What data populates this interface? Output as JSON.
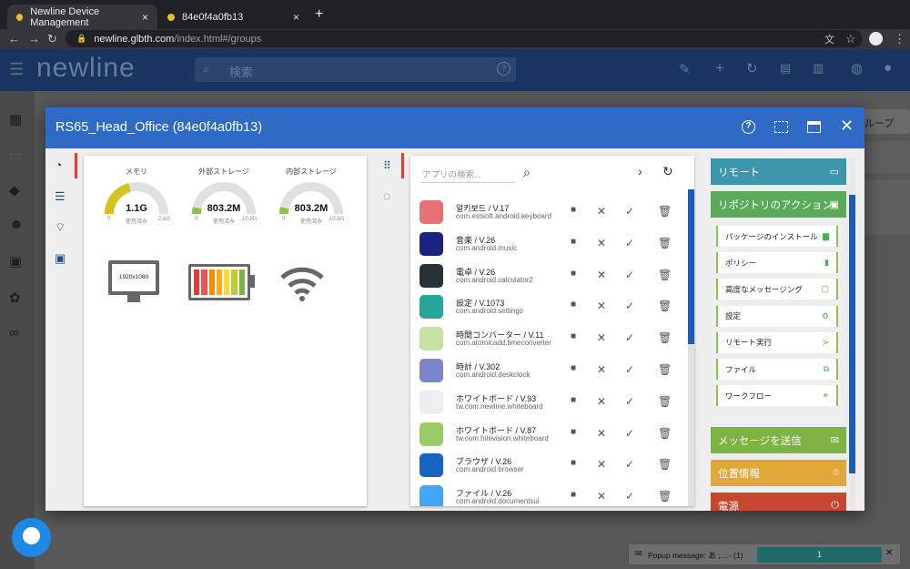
{
  "browser": {
    "tabs": [
      {
        "title": "Newline Device Management",
        "close": "×"
      },
      {
        "title": "84e0f4a0fb13",
        "close": "×"
      }
    ],
    "new_tab": "+",
    "url_domain": "newline.glbth.com",
    "url_path": "/index.html#/groups"
  },
  "app": {
    "logo": "newline",
    "search_placeholder": "検索",
    "help": "?",
    "bg_group_button": "ループ"
  },
  "modal": {
    "title": "RS65_Head_Office (84e0f4a0fb13)",
    "icons": [
      "help-icon",
      "screenshot-icon",
      "window-icon",
      "close-icon"
    ]
  },
  "gauges": [
    {
      "title": "メモリ",
      "value": "1.1G",
      "min": "0",
      "used_label": "使用済み",
      "max": "2.6G",
      "fraction": 0.42,
      "color": "#d4c21e"
    },
    {
      "title": "外部ストレージ",
      "value": "803.2M",
      "min": "0",
      "used_label": "使用済み",
      "max": "10.9G",
      "fraction": 0.07,
      "color": "#8bc34a"
    },
    {
      "title": "内部ストレージ",
      "value": "803.2M",
      "min": "0",
      "used_label": "使用済み",
      "max": "10.9G",
      "fraction": 0.07,
      "color": "#8bc34a"
    }
  ],
  "device": {
    "resolution": "1920x1080"
  },
  "apps": {
    "search_placeholder": "アプリの検索...",
    "items": [
      {
        "name": "알키보드 / V.17",
        "pkg": "com.estsoft.android.keyboard",
        "color": "#e57373"
      },
      {
        "name": "音楽 / V.26",
        "pkg": "com.android.music",
        "color": "#1a237e"
      },
      {
        "name": "電卓 / V.26",
        "pkg": "com.android.calculator2",
        "color": "#263238"
      },
      {
        "name": "設定 / V.1073",
        "pkg": "com.android.settings",
        "color": "#26a69a"
      },
      {
        "name": "時間コンバーター / V.11",
        "pkg": "com.atomicadd.timeconverter",
        "color": "#c5e1a5"
      },
      {
        "name": "時計 / V.302",
        "pkg": "com.android.deskclock",
        "color": "#7986cb"
      },
      {
        "name": "ホワイトボード / V.93",
        "pkg": "tw.com.newline.whiteboard",
        "color": "#eceff1"
      },
      {
        "name": "ホワイトボード / V.87",
        "pkg": "tw.com.hitevision.whiteboard",
        "color": "#9ccc65"
      },
      {
        "name": "ブラウザ / V.26",
        "pkg": "com.android.browser",
        "color": "#1565c0"
      },
      {
        "name": "ファイル / V.26",
        "pkg": "com.android.documentsui",
        "color": "#42a5f5"
      }
    ]
  },
  "actions": {
    "remote": "リモート",
    "repo": "リポジトリのアクション",
    "sub_items": [
      "パッケージのインストール",
      "ポリシー",
      "高度なメッセージング",
      "設定",
      "リモート実行",
      "ファイル",
      "ワークフロー"
    ],
    "send_message": "メッセージを送信",
    "location": "位置情報",
    "power": "電源"
  },
  "popup": {
    "text": "Popup message: あ ;....- (1)",
    "count": "1"
  },
  "colors": {
    "modal_header": "#2e6ac6",
    "remote": "#3d96ac",
    "repo": "#5aaa5a",
    "send": "#7cb342",
    "location": "#e0a83b",
    "power": "#c9452f"
  }
}
